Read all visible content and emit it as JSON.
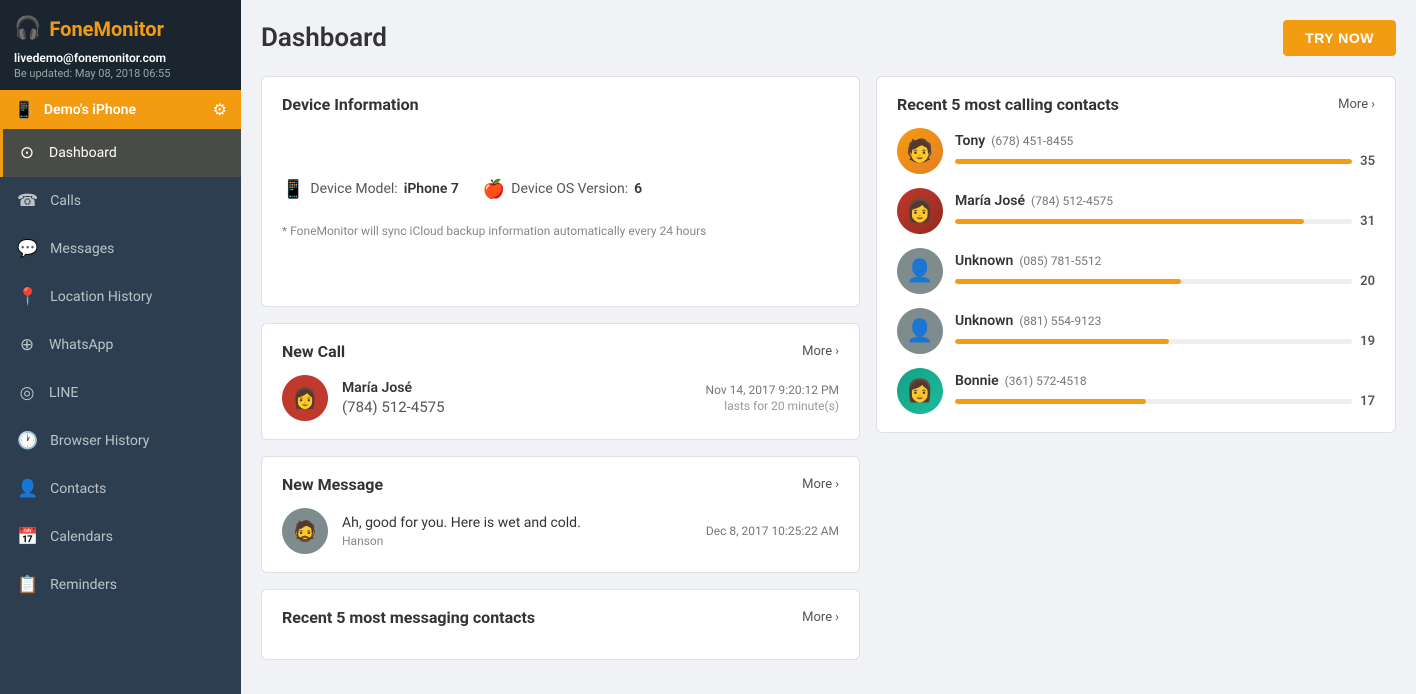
{
  "sidebar": {
    "logo_icon": "🎧",
    "logo_text": "FoneMonitor",
    "user_email": "livedemo@fonemonitor.com",
    "user_updated": "Be updated: May 08, 2018 06:55",
    "device_name": "Demo's iPhone",
    "nav_items": [
      {
        "id": "dashboard",
        "label": "Dashboard",
        "icon": "⊙",
        "active": true
      },
      {
        "id": "calls",
        "label": "Calls",
        "icon": "☎",
        "active": false
      },
      {
        "id": "messages",
        "label": "Messages",
        "icon": "💬",
        "active": false
      },
      {
        "id": "location-history",
        "label": "Location History",
        "icon": "📍",
        "active": false
      },
      {
        "id": "whatsapp",
        "label": "WhatsApp",
        "icon": "⊕",
        "active": false
      },
      {
        "id": "line",
        "label": "LINE",
        "icon": "◎",
        "active": false
      },
      {
        "id": "browser-history",
        "label": "Browser History",
        "icon": "🕐",
        "active": false
      },
      {
        "id": "contacts",
        "label": "Contacts",
        "icon": "👤",
        "active": false
      },
      {
        "id": "calendars",
        "label": "Calendars",
        "icon": "📅",
        "active": false
      },
      {
        "id": "reminders",
        "label": "Reminders",
        "icon": "📋",
        "active": false
      }
    ]
  },
  "header": {
    "page_title": "Dashboard",
    "try_now_label": "TRY NOW"
  },
  "device_info": {
    "card_title": "Device Information",
    "model_label": "Device Model:",
    "model_value": "iPhone 7",
    "os_label": "Device OS Version:",
    "os_value": "6",
    "note": "* FoneMonitor will sync iCloud backup information automatically every 24 hours"
  },
  "new_call": {
    "card_title": "New Call",
    "more_label": "More",
    "caller_name": "María José",
    "caller_number": "(784) 512-4575",
    "call_date": "Nov 14, 2017 9:20:12 PM",
    "call_duration": "lasts for 20 minute(s)"
  },
  "new_message": {
    "card_title": "New Message",
    "more_label": "More",
    "message_text": "Ah, good for you. Here is wet and cold.",
    "message_date": "Dec 8, 2017 10:25:22 AM",
    "sender": "Hanson"
  },
  "recent_messaging": {
    "card_title": "Recent 5 most messaging contacts",
    "more_label": "More"
  },
  "calling_contacts": {
    "card_title": "Recent 5 most calling contacts",
    "more_label": "More",
    "contacts": [
      {
        "name": "Tony",
        "phone": "(678) 451-8455",
        "count": 35,
        "bar_pct": 100,
        "avatar_type": "tony"
      },
      {
        "name": "María José",
        "phone": "(784) 512-4575",
        "count": 31,
        "bar_pct": 88,
        "avatar_type": "maria"
      },
      {
        "name": "Unknown",
        "phone": "(085) 781-5512",
        "count": 20,
        "bar_pct": 57,
        "avatar_type": "unknown"
      },
      {
        "name": "Unknown",
        "phone": "(881) 554-9123",
        "count": 19,
        "bar_pct": 54,
        "avatar_type": "unknown"
      },
      {
        "name": "Bonnie",
        "phone": "(361) 572-4518",
        "count": 17,
        "bar_pct": 48,
        "avatar_type": "bonnie"
      }
    ]
  }
}
